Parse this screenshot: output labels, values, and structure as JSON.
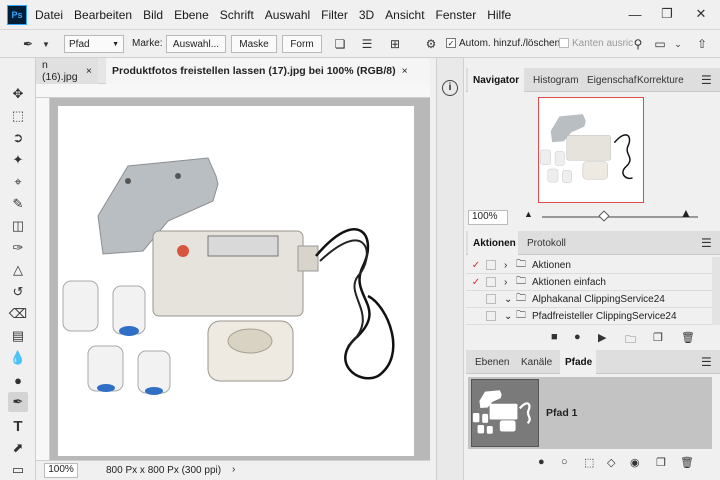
{
  "app": {
    "logo": "Ps"
  },
  "menu": [
    "Datei",
    "Bearbeiten",
    "Bild",
    "Ebene",
    "Schrift",
    "Auswahl",
    "Filter",
    "3D",
    "Ansicht",
    "Fenster",
    "Hilfe"
  ],
  "options_bar": {
    "path_mode": "Pfad",
    "marke_label": "Marke:",
    "auswahl_label": "Auswahl...",
    "maske_label": "Maske",
    "form_label": "Form",
    "auto_add_label": "Autom. hinzuf./löschen",
    "kanten_label": "Kanten ausric"
  },
  "doc_tabs": {
    "tab1": "n (16).jpg",
    "tab2": "Produktfotos freistellen lassen (17).jpg bei 100% (RGB/8)"
  },
  "status": {
    "zoom": "100%",
    "info": "800 Px x 800 Px (300 ppi)"
  },
  "navigator": {
    "tabs": [
      "Navigator",
      "Histogram",
      "Eigenschaf",
      "Korrekture"
    ],
    "zoom": "100%"
  },
  "actions_panel": {
    "tabs": [
      "Aktionen",
      "Protokoll"
    ],
    "items": [
      {
        "name": "Aktionen",
        "checked": true
      },
      {
        "name": "Aktionen einfach",
        "checked": true
      },
      {
        "name": "Alphakanal ClippingService24",
        "checked": false
      },
      {
        "name": "Pfadfreisteller ClippingService24",
        "checked": false
      }
    ]
  },
  "layers_panel": {
    "tabs": [
      "Ebenen",
      "Kanäle",
      "Pfade"
    ],
    "path_name": "Pfad 1"
  },
  "colors": {
    "accent": "#31a8ff",
    "check_red": "#d0312d",
    "thumb_dark": "#7a7a7a"
  }
}
